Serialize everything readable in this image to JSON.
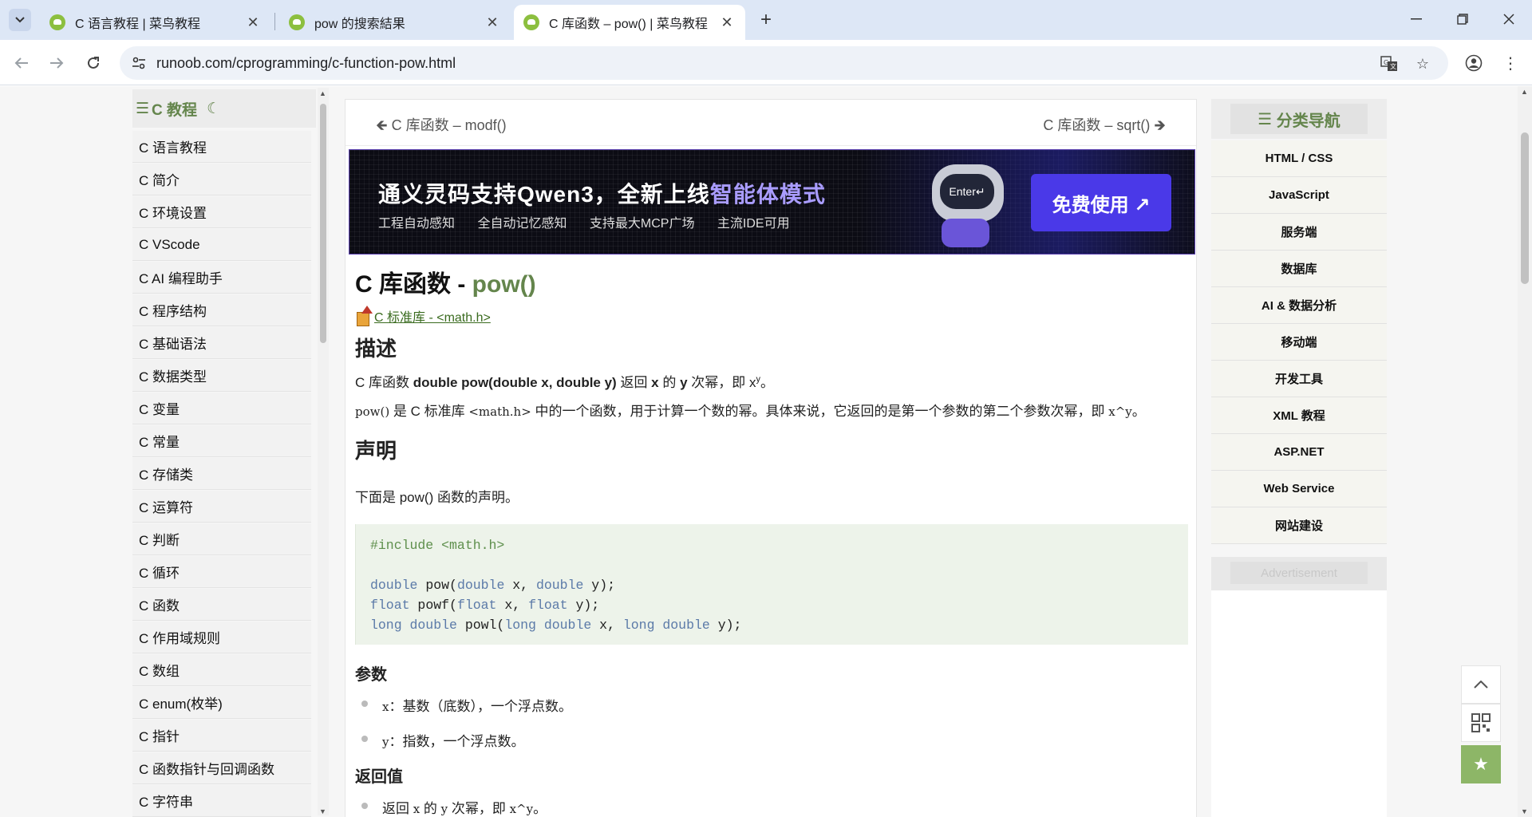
{
  "browser": {
    "tabs": [
      {
        "title": "C 语言教程 | 菜鸟教程",
        "active": false
      },
      {
        "title": "pow 的搜索結果",
        "active": false
      },
      {
        "title": "C 库函数 – pow() | 菜鸟教程",
        "active": true
      }
    ],
    "url": "runoob.com/cprogramming/c-function-pow.html"
  },
  "sidebar": {
    "title": "C 教程",
    "items": [
      "C 语言教程",
      "C 简介",
      "C 环境设置",
      "C VScode",
      "C AI 编程助手",
      "C 程序结构",
      "C 基础语法",
      "C 数据类型",
      "C 变量",
      "C 常量",
      "C 存储类",
      "C 运算符",
      "C 判断",
      "C 循环",
      "C 函数",
      "C 作用域规则",
      "C 数组",
      "C enum(枚举)",
      "C 指针",
      "C 函数指针与回调函数",
      "C 字符串"
    ]
  },
  "article": {
    "prev": "C 库函数 – modf()",
    "next": "C 库函数 – sqrt()",
    "banner": {
      "title_prefix": "通义灵码支持Qwen3，全新上线",
      "title_highlight": "智能体模式",
      "subtitle": "工程自动感知 全自动记忆感知 支持最大MCP广场 主流IDE可用",
      "robot_label": "Enter↵",
      "cta": "免费使用 ↗"
    },
    "title_prefix": "C 库函数 - ",
    "title_fn": "pow()",
    "stdlib_link": "C 标准库 - <math.h>",
    "desc_heading": "描述",
    "desc_line1": {
      "a": "C 库函数 ",
      "b": "double pow(double x, double y)",
      "c": " 返回 ",
      "d": "x",
      "e": " 的 ",
      "f": "y",
      "g": " 次幂，即 x",
      "h": "y",
      "i": "。"
    },
    "desc_line2": {
      "a": "pow()",
      "b": " 是 C 标准库 ",
      "c": "<math.h>",
      "d": " 中的一个函数，用于计算一个数的幂。具体来说，它返回的是第一个参数的第二个参数次幂，即 ",
      "e": "x^y",
      "f": "。"
    },
    "decl_heading": "声明",
    "decl_text": "下面是 pow() 函数的声明。",
    "code": {
      "include": "#include <math.h>",
      "l1_kw1": "double",
      "l1_fn": " pow(",
      "l1_kw2": "double",
      "l1_mid": " x, ",
      "l1_kw3": "double",
      "l1_end": " y);",
      "l2_kw1": "float",
      "l2_fn": " powf(",
      "l2_kw2": "float",
      "l2_mid": " x, ",
      "l2_kw3": "float",
      "l2_end": " y);",
      "l3_kw1": "long double",
      "l3_fn": " powl(",
      "l3_kw2": "long double",
      "l3_mid": " x, ",
      "l3_kw3": "long double",
      "l3_end": " y);"
    },
    "params_heading": "参数",
    "params": [
      {
        "name": "x",
        "text": "：基数（底数），一个浮点数。"
      },
      {
        "name": "y",
        "text": "：指数，一个浮点数。"
      }
    ],
    "return_heading": "返回值",
    "return_item": {
      "a": "返回 ",
      "b": "x",
      "c": " 的 ",
      "d": "y",
      "e": " 次幂，即 ",
      "f": "x^y",
      "g": "。"
    }
  },
  "right_nav": {
    "title": "分类导航",
    "items": [
      "HTML / CSS",
      "JavaScript",
      "服务端",
      "数据库",
      "AI & 数据分析",
      "移动端",
      "开发工具",
      "XML 教程",
      "ASP.NET",
      "Web Service",
      "网站建设"
    ],
    "ad_label": "Advertisement"
  },
  "colors": {
    "accent": "#64854c",
    "tab_bar": "#dde7f6",
    "fav_button": "#8db667"
  }
}
